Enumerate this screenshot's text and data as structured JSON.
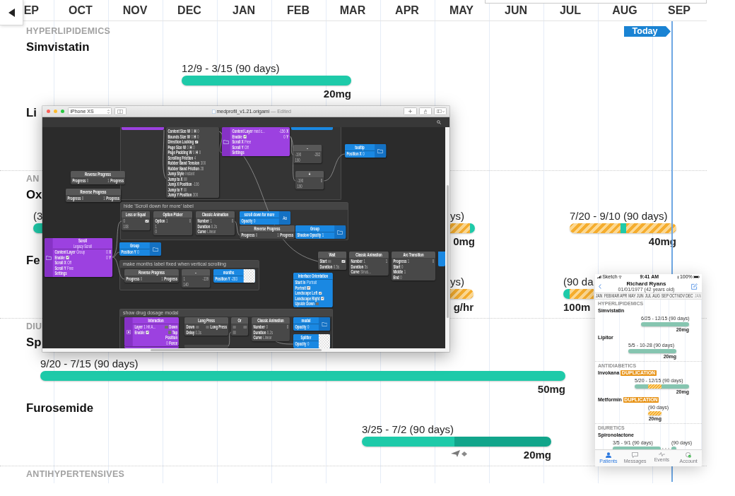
{
  "timeline": {
    "months": [
      "EP",
      "OCT",
      "NOV",
      "DEC",
      "JAN",
      "FEB",
      "MAR",
      "APR",
      "MAY",
      "JUN",
      "JUL",
      "AUG",
      "SEP"
    ],
    "today": "Today",
    "sections": [
      {
        "title": "HYPERLIPIDEMICS",
        "drugs": [
          {
            "name": "Simvistatin",
            "courses": [
              {
                "dates": "12/9 - 3/15 (90 days)",
                "dose": "20mg",
                "segments": [
                  {
                    "kind": "active"
                  }
                ]
              }
            ]
          },
          {
            "name": "Li"
          }
        ]
      },
      {
        "title": "AN",
        "drugs": [
          {
            "name": "Ox",
            "courses": [
              {
                "dates": "(3",
                "segments": [
                  {
                    "kind": "active"
                  }
                ]
              },
              {
                "dates": "ys)",
                "dose": "0mg",
                "segments": [
                  {
                    "kind": "duplicate"
                  },
                  {
                    "kind": "active"
                  }
                ]
              },
              {
                "dates": "7/20 - 9/10 (90 days)",
                "dose": "40mg",
                "segments": [
                  {
                    "kind": "duplicate"
                  },
                  {
                    "kind": "active"
                  },
                  {
                    "kind": "duplicate"
                  }
                ]
              }
            ]
          },
          {
            "name": "Fe",
            "courses": [
              {
                "dates": "ys)",
                "dose": "g/hr",
                "segments": [
                  {
                    "kind": "duplicate"
                  }
                ]
              },
              {
                "dates": "(90 da",
                "dose": "100m",
                "segments": [
                  {
                    "kind": "active"
                  },
                  {
                    "kind": "duplicate"
                  }
                ]
              }
            ]
          }
        ]
      },
      {
        "title": "DIU",
        "drugs": [
          {
            "name": "Sp",
            "courses": [
              {
                "dates": "9/20 - 7/15 (90 days)",
                "dose": "50mg",
                "segments": [
                  {
                    "kind": "active"
                  }
                ]
              }
            ]
          },
          {
            "name": "Furosemide",
            "courses": [
              {
                "dates": "3/25 - 7/2 (90 days)",
                "dose": "20mg",
                "marker": true,
                "segments": [
                  {
                    "kind": "active"
                  },
                  {
                    "kind": "remaining"
                  }
                ]
              }
            ]
          }
        ]
      },
      {
        "title": "ANTIHYPERTENSIVES"
      }
    ]
  },
  "editor": {
    "device": "iPhone XS",
    "title": "medprofil_v1.21.origami",
    "status": "— Edited",
    "frames": [
      {
        "label": "hide 'Scroll down for more' label"
      },
      {
        "label": "make months label fixed when vertical scrolling"
      },
      {
        "label": "show drug dosage modal"
      }
    ],
    "nodes": [
      {
        "kind": "patch",
        "rows": [
          {
            "left": [
              {
                "kind": "label",
                "text": "Content Size W"
              },
              {
                "kind": "value",
                "text": "0"
              },
              {
                "kind": "label",
                "text": "H"
              },
              {
                "kind": "value",
                "text": "0"
              }
            ]
          },
          {
            "left": [
              {
                "kind": "label",
                "text": "Bounds Size W"
              },
              {
                "kind": "value",
                "text": "0"
              },
              {
                "kind": "label",
                "text": "H"
              },
              {
                "kind": "value",
                "text": "0"
              }
            ]
          },
          {
            "left": [
              {
                "kind": "label",
                "text": "Direction Locking"
              },
              {
                "kind": "check",
                "checked": true
              }
            ]
          },
          {
            "left": [
              {
                "kind": "label",
                "text": "Page Size W"
              },
              {
                "kind": "value",
                "text": "0"
              },
              {
                "kind": "label",
                "text": "H"
              },
              {
                "kind": "value",
                "text": "0"
              }
            ]
          },
          {
            "left": [
              {
                "kind": "label",
                "text": "Page Padding W"
              },
              {
                "kind": "value",
                "text": "0"
              },
              {
                "kind": "label",
                "text": "H"
              },
              {
                "kind": "value",
                "text": "0"
              }
            ]
          },
          {
            "left": [
              {
                "kind": "label",
                "text": "Scrolling Friction"
              },
              {
                "kind": "value",
                "text": "4"
              }
            ]
          },
          {
            "left": [
              {
                "kind": "label",
                "text": "Rubber Band Tension"
              },
              {
                "kind": "value",
                "text": "300"
              }
            ]
          },
          {
            "left": [
              {
                "kind": "label",
                "text": "Rubber Band Friction"
              },
              {
                "kind": "value",
                "text": "28"
              }
            ]
          },
          {
            "left": [
              {
                "kind": "label",
                "text": "Jump Style"
              },
              {
                "kind": "value",
                "text": "Instant"
              }
            ]
          },
          {
            "left": [
              {
                "kind": "label",
                "text": "Jump to X"
              },
              {
                "kind": "check",
                "checked": false
              }
            ]
          },
          {
            "left": [
              {
                "kind": "label",
                "text": "Jump X Position"
              },
              {
                "kind": "value",
                "text": "-106"
              }
            ]
          },
          {
            "left": [
              {
                "kind": "label",
                "text": "Jump to Y"
              },
              {
                "kind": "check",
                "checked": false
              }
            ]
          },
          {
            "left": [
              {
                "kind": "label",
                "text": "Jump Y Position"
              },
              {
                "kind": "value",
                "text": "300"
              }
            ]
          }
        ]
      },
      {
        "kind": "interaction",
        "preview": {
          "kind": "folder"
        },
        "rows": [
          {
            "left": [
              {
                "kind": "label",
                "text": "Content Layer"
              },
              {
                "kind": "value",
                "text": "med c..."
              }
            ],
            "right": [
              {
                "kind": "value",
                "text": "-156"
              },
              {
                "kind": "label",
                "text": "X"
              }
            ]
          },
          {
            "left": [
              {
                "kind": "label",
                "text": "Enable"
              },
              {
                "kind": "check",
                "checked": true
              }
            ],
            "right": [
              {
                "kind": "value",
                "text": "0"
              },
              {
                "kind": "label",
                "text": "Y"
              }
            ]
          },
          {
            "left": [
              {
                "kind": "label",
                "text": "Scroll X"
              },
              {
                "kind": "value",
                "text": "Free"
              }
            ]
          },
          {
            "left": [
              {
                "kind": "label",
                "text": "Scroll Y"
              },
              {
                "kind": "value",
                "text": "Off"
              }
            ]
          },
          {
            "left": [
              {
                "kind": "label",
                "text": "Settings"
              }
            ]
          }
        ]
      },
      {
        "kind": "patch",
        "title": "-",
        "rows": [
          {
            "left": [
              {
                "kind": "value",
                "text": "-190"
              }
            ],
            "right": [
              {
                "kind": "value",
                "text": "-282"
              }
            ]
          },
          {
            "left": [
              {
                "kind": "value",
                "text": "190"
              }
            ]
          }
        ]
      },
      {
        "kind": "layer",
        "title": "tooltip",
        "preview": {
          "kind": "folder"
        },
        "rows": [
          {
            "left": [
              {
                "kind": "label",
                "text": "Position X"
              },
              {
                "kind": "value",
                "text": "0"
              }
            ]
          }
        ]
      },
      {
        "kind": "patch",
        "title": "Reverse Progress",
        "rows": [
          {
            "left": [
              {
                "kind": "label",
                "text": "Progress"
              },
              {
                "kind": "value",
                "text": "0"
              }
            ],
            "right": [
              {
                "kind": "value",
                "text": "1"
              },
              {
                "kind": "label",
                "text": "Progress"
              }
            ]
          }
        ]
      },
      {
        "kind": "patch",
        "title": "+",
        "rows": [
          {
            "left": [
              {
                "kind": "value",
                "text": "-190"
              }
            ],
            "right": [
              {
                "kind": "value",
                "text": "0"
              }
            ]
          },
          {
            "left": [
              {
                "kind": "value",
                "text": "190"
              }
            ]
          }
        ]
      },
      {
        "kind": "patch",
        "title": "Reverse Progress",
        "rows": [
          {
            "left": [
              {
                "kind": "label",
                "text": "Progress"
              },
              {
                "kind": "value",
                "text": "0"
              }
            ],
            "right": [
              {
                "kind": "value",
                "text": "1"
              },
              {
                "kind": "label",
                "text": "Progress"
              }
            ]
          }
        ]
      },
      {
        "kind": "patch",
        "title": "Less or Equal",
        "rows": [
          {
            "left": [
              {
                "kind": "value",
                "text": "0"
              }
            ],
            "right": [
              {
                "kind": "check",
                "checked": true
              }
            ]
          },
          {
            "left": [
              {
                "kind": "value",
                "text": "108"
              }
            ]
          }
        ]
      },
      {
        "kind": "patch",
        "title": "Option Picker",
        "rows": [
          {
            "left": [
              {
                "kind": "label",
                "text": "Option"
              },
              {
                "kind": "value",
                "text": "1"
              }
            ],
            "right": [
              {
                "kind": "value",
                "text": "0"
              }
            ]
          },
          {
            "left": [
              {
                "kind": "value",
                "text": "1"
              }
            ]
          },
          {
            "left": [
              {
                "kind": "value",
                "text": "0"
              }
            ]
          }
        ]
      },
      {
        "kind": "patch",
        "title": "Classic Animation",
        "rows": [
          {
            "left": [
              {
                "kind": "label",
                "text": "Number"
              },
              {
                "kind": "value",
                "text": "1"
              }
            ],
            "right": [
              {
                "kind": "value",
                "text": "0"
              }
            ]
          },
          {
            "left": [
              {
                "kind": "label",
                "text": "Duration"
              },
              {
                "kind": "value",
                "text": "0.2s"
              }
            ]
          },
          {
            "left": [
              {
                "kind": "label",
                "text": "Curve"
              },
              {
                "kind": "value",
                "text": "Linear"
              }
            ]
          }
        ]
      },
      {
        "kind": "layer",
        "title": "scroll down for more",
        "preview": {
          "kind": "text",
          "text": "Aa"
        },
        "rows": [
          {
            "left": [
              {
                "kind": "label",
                "text": "Opacity"
              },
              {
                "kind": "value",
                "text": "0"
              }
            ]
          }
        ]
      },
      {
        "kind": "patch",
        "title": "Reverse Progress",
        "rows": [
          {
            "left": [
              {
                "kind": "label",
                "text": "Progress"
              },
              {
                "kind": "value",
                "text": "0"
              }
            ],
            "right": [
              {
                "kind": "value",
                "text": "1"
              },
              {
                "kind": "label",
                "text": "Progress"
              }
            ]
          }
        ]
      },
      {
        "kind": "layer",
        "title": "Group",
        "preview": {
          "kind": "folder"
        },
        "rows": [
          {
            "left": [
              {
                "kind": "label",
                "text": "Shadow Opacity"
              },
              {
                "kind": "value",
                "text": "1"
              }
            ]
          }
        ]
      },
      {
        "kind": "interaction",
        "title": "Scroll",
        "subtitle": "Legacy Scroll",
        "preview": {
          "kind": "folder"
        },
        "rows": [
          {
            "left": [
              {
                "kind": "label",
                "text": "Content Layer"
              },
              {
                "kind": "value",
                "text": "Group"
              }
            ],
            "right": [
              {
                "kind": "value",
                "text": "0"
              },
              {
                "kind": "label",
                "text": "X"
              }
            ]
          },
          {
            "left": [
              {
                "kind": "label",
                "text": "Enable"
              },
              {
                "kind": "check",
                "checked": true
              }
            ],
            "right": [
              {
                "kind": "value",
                "text": "0"
              },
              {
                "kind": "label",
                "text": "Y"
              }
            ]
          },
          {
            "left": [
              {
                "kind": "label",
                "text": "Scroll X"
              },
              {
                "kind": "value",
                "text": "Off"
              }
            ]
          },
          {
            "left": [
              {
                "kind": "label",
                "text": "Scroll Y"
              },
              {
                "kind": "value",
                "text": "Free"
              }
            ]
          },
          {
            "left": [
              {
                "kind": "label",
                "text": "Settings"
              }
            ]
          }
        ]
      },
      {
        "kind": "layer",
        "title": "Group",
        "preview": {
          "kind": "folder"
        },
        "rows": [
          {
            "left": [
              {
                "kind": "label",
                "text": "Position Y"
              },
              {
                "kind": "value",
                "text": "0"
              }
            ]
          }
        ]
      },
      {
        "kind": "patch",
        "title": "Wait",
        "rows": [
          {
            "left": [
              {
                "kind": "label",
                "text": "Start"
              },
              {
                "kind": "check",
                "checked": false
              }
            ],
            "right": [
              {
                "kind": "check",
                "checked": true
              }
            ]
          },
          {
            "left": [
              {
                "kind": "label",
                "text": "Duration"
              },
              {
                "kind": "value",
                "text": "0.5s"
              }
            ]
          }
        ]
      },
      {
        "kind": "patch",
        "title": "Reverse Progress",
        "rows": [
          {
            "left": [
              {
                "kind": "label",
                "text": "Progress"
              },
              {
                "kind": "value",
                "text": "0"
              }
            ],
            "right": [
              {
                "kind": "value",
                "text": "1"
              },
              {
                "kind": "label",
                "text": "Progress"
              }
            ]
          }
        ]
      },
      {
        "kind": "patch",
        "title": "-",
        "rows": [
          {
            "left": [
              {
                "kind": "value",
                "text": "1"
              }
            ],
            "right": [
              {
                "kind": "value",
                "text": "-139"
              }
            ]
          },
          {
            "left": [
              {
                "kind": "value",
                "text": "140"
              }
            ]
          }
        ]
      },
      {
        "kind": "layer",
        "title": "months",
        "preview": {
          "kind": "image"
        },
        "rows": [
          {
            "left": [
              {
                "kind": "label",
                "text": "Position Y"
              },
              {
                "kind": "value",
                "text": "-283"
              }
            ]
          }
        ]
      },
      {
        "kind": "layer",
        "title": "Interface Orientation",
        "rows": [
          {
            "left": [
              {
                "kind": "label",
                "text": "Start In"
              },
              {
                "kind": "value",
                "text": "Portrait"
              }
            ]
          },
          {
            "left": [
              {
                "kind": "label",
                "text": "Portrait"
              },
              {
                "kind": "check",
                "checked": true
              }
            ]
          },
          {
            "left": [
              {
                "kind": "label",
                "text": "Landscape Left"
              },
              {
                "kind": "check",
                "checked": true
              }
            ]
          },
          {
            "left": [
              {
                "kind": "label",
                "text": "Landscape Right"
              },
              {
                "kind": "check",
                "checked": true
              }
            ]
          },
          {
            "left": [
              {
                "kind": "label",
                "text": "Upside Down"
              },
              {
                "kind": "check",
                "checked": false
              }
            ]
          }
        ]
      },
      {
        "kind": "patch",
        "title": "Classic Animation",
        "rows": [
          {
            "left": [
              {
                "kind": "label",
                "text": "Number"
              },
              {
                "kind": "value",
                "text": "1"
              }
            ],
            "right": [
              {
                "kind": "value",
                "text": "1"
              }
            ]
          },
          {
            "left": [
              {
                "kind": "label",
                "text": "Duration"
              },
              {
                "kind": "value",
                "text": "5s"
              }
            ]
          },
          {
            "left": [
              {
                "kind": "label",
                "text": "Curve"
              },
              {
                "kind": "value",
                "text": "Sinus..."
              }
            ]
          }
        ]
      },
      {
        "kind": "patch",
        "title": "Arc Transition",
        "rows": [
          {
            "left": [
              {
                "kind": "label",
                "text": "Progress"
              },
              {
                "kind": "value",
                "text": "1"
              }
            ],
            "right": [
              {
                "kind": "value",
                "text": "0"
              }
            ]
          },
          {
            "left": [
              {
                "kind": "label",
                "text": "Start"
              },
              {
                "kind": "value",
                "text": "0"
              }
            ]
          },
          {
            "left": [
              {
                "kind": "label",
                "text": "Middle"
              },
              {
                "kind": "value",
                "text": "1"
              }
            ]
          },
          {
            "left": [
              {
                "kind": "label",
                "text": "End"
              },
              {
                "kind": "value",
                "text": "0"
              }
            ]
          }
        ]
      },
      {
        "kind": "interaction",
        "title": "Interaction",
        "preview": {
          "kind": "target"
        },
        "rows": [
          {
            "left": [
              {
                "kind": "label",
                "text": "Layer"
              },
              {
                "kind": "value",
                "text": "1 Hit A..."
              }
            ],
            "right": [
              {
                "kind": "check",
                "checked": false
              },
              {
                "kind": "label",
                "text": "Down"
              }
            ]
          },
          {
            "left": [
              {
                "kind": "label",
                "text": "Enable"
              },
              {
                "kind": "check",
                "checked": true
              }
            ],
            "right": [
              {
                "kind": "check",
                "checked": false
              },
              {
                "kind": "label",
                "text": "Tap"
              }
            ]
          },
          {
            "right": [
              {
                "kind": "label",
                "text": "Position"
              }
            ]
          },
          {
            "right": [
              {
                "kind": "value",
                "text": "0"
              },
              {
                "kind": "label",
                "text": "Force"
              }
            ]
          }
        ]
      },
      {
        "kind": "patch",
        "title": "Long Press",
        "rows": [
          {
            "left": [
              {
                "kind": "label",
                "text": "Down"
              },
              {
                "kind": "check",
                "checked": false
              }
            ],
            "right": [
              {
                "kind": "check",
                "checked": false
              },
              {
                "kind": "label",
                "text": "Long Press"
              }
            ]
          },
          {
            "left": [
              {
                "kind": "label",
                "text": "Delay"
              },
              {
                "kind": "value",
                "text": "0.3s"
              }
            ]
          }
        ]
      },
      {
        "kind": "patch",
        "title": "Or",
        "rows": [
          {
            "left": [
              {
                "kind": "check",
                "checked": false
              }
            ],
            "right": [
              {
                "kind": "check",
                "checked": false
              }
            ]
          },
          {
            "left": [
              {
                "kind": "check",
                "checked": false
              }
            ]
          }
        ]
      },
      {
        "kind": "patch",
        "title": "Classic Animation",
        "rows": [
          {
            "left": [
              {
                "kind": "label",
                "text": "Number"
              },
              {
                "kind": "value",
                "text": "0"
              }
            ],
            "right": [
              {
                "kind": "value",
                "text": "0"
              }
            ]
          },
          {
            "left": [
              {
                "kind": "label",
                "text": "Duration"
              },
              {
                "kind": "value",
                "text": "0.2s"
              }
            ]
          },
          {
            "left": [
              {
                "kind": "label",
                "text": "Curve"
              },
              {
                "kind": "value",
                "text": "Linear"
              }
            ]
          }
        ]
      },
      {
        "kind": "layer",
        "title": "modal",
        "preview": {
          "kind": "folder"
        },
        "rows": [
          {
            "left": [
              {
                "kind": "label",
                "text": "Opacity"
              },
              {
                "kind": "value",
                "text": "0"
              }
            ]
          }
        ]
      },
      {
        "kind": "layer",
        "title": "Splitter",
        "preview": {
          "kind": "image"
        },
        "rows": [
          {
            "left": [
              {
                "kind": "label",
                "text": "Opacity"
              },
              {
                "kind": "value",
                "text": "0"
              }
            ]
          }
        ]
      }
    ]
  },
  "phone": {
    "carrier": "Sketch",
    "time": "9:41 AM",
    "battery": "100%",
    "name": "Richard Ryans",
    "birth_date": "01/01/1977 (42 years old)",
    "months": [
      {
        "label": "JAN",
        "dimmed": false
      },
      {
        "label": "FEB",
        "dimmed": false
      },
      {
        "label": "MAR",
        "dimmed": false
      },
      {
        "label": "APR",
        "dimmed": false
      },
      {
        "label": "MAY",
        "dimmed": false
      },
      {
        "label": "JUN",
        "dimmed": false
      },
      {
        "label": "JUL",
        "dimmed": false
      },
      {
        "label": "AUG",
        "dimmed": false
      },
      {
        "label": "SEP",
        "dimmed": false
      },
      {
        "label": "OCT",
        "dimmed": false
      },
      {
        "label": "NOV",
        "dimmed": false
      },
      {
        "label": "DEC",
        "dimmed": false
      },
      {
        "label": "JAN",
        "dimmed": true
      }
    ],
    "sections": [
      {
        "title": "HYPERLIPIDEMICS",
        "drugs": [
          {
            "name": "Simvistatin",
            "courses": [
              {
                "dates": "6/25 - 12/15 (90 days)",
                "dose": "20mg",
                "segments": [
                  {
                    "kind": "active"
                  }
                ]
              }
            ]
          },
          {
            "name": "Lipitor",
            "courses": [
              {
                "dates": "5/5 - 10-28 (90 days)",
                "dose": "20mg",
                "segments": [
                  {
                    "kind": "active"
                  }
                ]
              }
            ]
          }
        ]
      },
      {
        "title": "ANTIDIABETICS",
        "drugs": [
          {
            "name": "Invokana",
            "badge": "DUPLICATION",
            "courses": [
              {
                "dates": "5/20 - 12/15 (90 days)",
                "dose": "20mg",
                "segments": [
                  {
                    "kind": "active"
                  },
                  {
                    "kind": "duplicate"
                  },
                  {
                    "kind": "active"
                  }
                ]
              }
            ]
          },
          {
            "name": "Metformin",
            "badge": "DUPLICATION",
            "courses": [
              {
                "dates": "(90 days)",
                "dose": "20mg",
                "segments": [
                  {
                    "kind": "duplicate"
                  }
                ]
              }
            ]
          }
        ]
      },
      {
        "title": "DIURETICS",
        "drugs": [
          {
            "name": "Spironolactone",
            "courses": [
              {
                "dates": "3/5 - 9/1 (90 days)",
                "gap": true,
                "segments": [
                  {
                    "kind": "active"
                  }
                ]
              },
              {
                "dates": "(90 days)",
                "segments": [
                  {
                    "kind": "active"
                  }
                ]
              }
            ]
          }
        ]
      }
    ],
    "tabs": [
      {
        "label": "Patients",
        "selected": true
      },
      {
        "label": "Messages",
        "selected": false
      },
      {
        "label": "Events",
        "selected": false
      },
      {
        "label": "Account",
        "selected": false
      }
    ]
  }
}
